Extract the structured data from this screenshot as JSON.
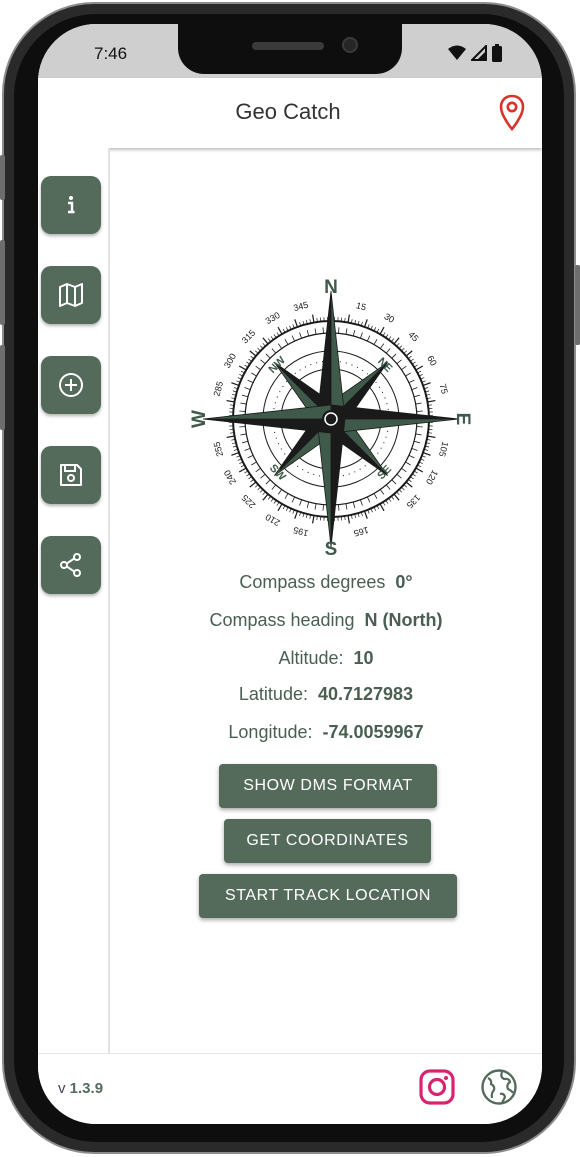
{
  "status": {
    "time": "7:46"
  },
  "app": {
    "title": "Geo Catch"
  },
  "sidebar": {
    "items": [
      {
        "name": "info",
        "icon": "info-icon"
      },
      {
        "name": "map",
        "icon": "map-icon"
      },
      {
        "name": "add",
        "icon": "plus-circle-icon"
      },
      {
        "name": "save",
        "icon": "save-icon"
      },
      {
        "name": "share",
        "icon": "share-icon"
      }
    ]
  },
  "compass": {
    "cardinals": [
      "N",
      "E",
      "S",
      "W"
    ],
    "intercardinals": [
      "NE",
      "SE",
      "SW",
      "NW"
    ],
    "degree_labels": [
      "15",
      "30",
      "45",
      "60",
      "75",
      "105",
      "120",
      "135",
      "165",
      "195",
      "210",
      "225",
      "240",
      "255",
      "285",
      "300",
      "315",
      "330",
      "345"
    ]
  },
  "readings": {
    "compass_degrees_label": "Compass degrees",
    "compass_degrees_value": "0°",
    "compass_heading_label": "Compass heading",
    "compass_heading_value": "N (North)",
    "altitude_label": "Altitude:",
    "altitude_value": "10",
    "latitude_label": "Latitude:",
    "latitude_value": "40.7127983",
    "longitude_label": "Longitude:",
    "longitude_value": "-74.0059967"
  },
  "buttons": {
    "dms": "SHOW DMS FORMAT",
    "coords": "GET COORDINATES",
    "track": "START TRACK LOCATION"
  },
  "footer": {
    "version_prefix": "v",
    "version": "1.3.9"
  },
  "colors": {
    "accent": "#546a5b",
    "pin": "#d9342b",
    "instagram": "#d6246e",
    "text": "#4a5f52"
  }
}
